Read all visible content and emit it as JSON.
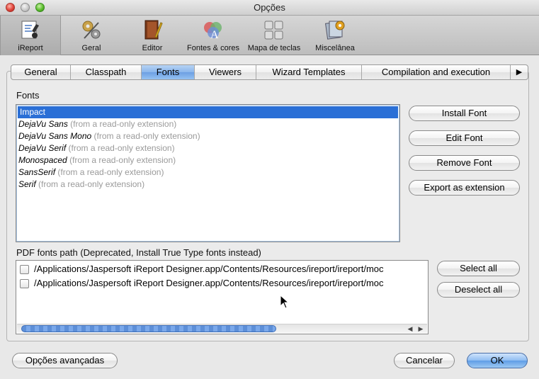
{
  "window": {
    "title": "Opções"
  },
  "toolbar": {
    "items": [
      {
        "label": "iReport",
        "icon": "ireport-icon"
      },
      {
        "label": "Geral",
        "icon": "gears-icon"
      },
      {
        "label": "Editor",
        "icon": "book-pen-icon"
      },
      {
        "label": "Fontes & cores",
        "icon": "fonts-colors-icon"
      },
      {
        "label": "Mapa de teclas",
        "icon": "keyboard-icon"
      },
      {
        "label": "Miscelânea",
        "icon": "misc-icon"
      }
    ]
  },
  "tabs": {
    "items": [
      "General",
      "Classpath",
      "Fonts",
      "Viewers",
      "Wizard Templates",
      "Compilation and execution"
    ],
    "selected": "Fonts",
    "more": "▶"
  },
  "fonts": {
    "label": "Fonts",
    "items": [
      {
        "name": "Impact",
        "note": ""
      },
      {
        "name": "DejaVu Sans",
        "note": "(from a read-only extension)"
      },
      {
        "name": "DejaVu Sans Mono",
        "note": "(from a read-only extension)"
      },
      {
        "name": "DejaVu Serif",
        "note": "(from a read-only extension)"
      },
      {
        "name": "Monospaced",
        "note": "(from a read-only extension)"
      },
      {
        "name": "SansSerif",
        "note": "(from a read-only extension)"
      },
      {
        "name": "Serif",
        "note": "(from a read-only extension)"
      }
    ],
    "buttons": {
      "install": "Install Font",
      "edit": "Edit Font",
      "remove": "Remove Font",
      "export": "Export as extension"
    }
  },
  "pdf": {
    "label": "PDF fonts path (Deprecated, Install True Type fonts instead)",
    "paths": [
      "/Applications/Jaspersoft iReport Designer.app/Contents/Resources/ireport/ireport/moc",
      "/Applications/Jaspersoft iReport Designer.app/Contents/Resources/ireport/ireport/moc"
    ],
    "buttons": {
      "select_all": "Select all",
      "deselect_all": "Deselect all"
    }
  },
  "footer": {
    "advanced": "Opções avançadas",
    "cancel": "Cancelar",
    "ok": "OK"
  },
  "colors": {
    "selection": "#2a6fd6",
    "default_button": "#5f9de6"
  }
}
